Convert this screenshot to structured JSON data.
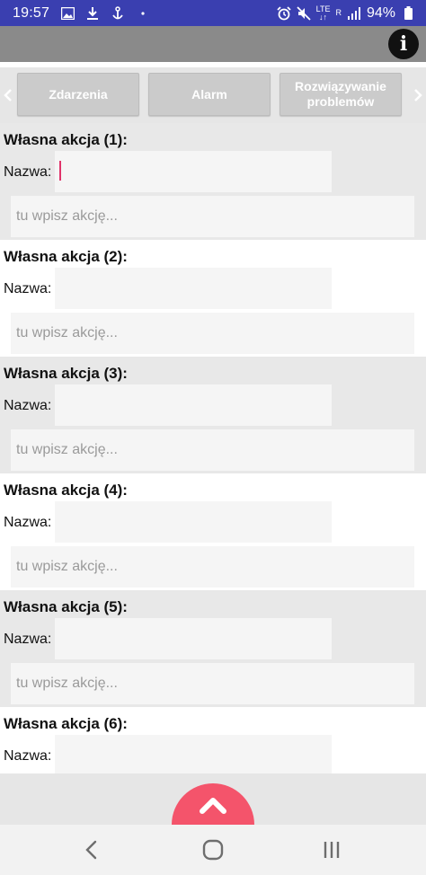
{
  "status_bar": {
    "time": "19:57",
    "network": "LTE",
    "roaming": "R",
    "battery": "94%"
  },
  "tabs": {
    "items": [
      {
        "label": "Zdarzenia"
      },
      {
        "label": "Alarm"
      },
      {
        "label": "Rozwiązywanie problemów"
      }
    ]
  },
  "sections": [
    {
      "title": "Własna akcja (1):",
      "name_label": "Nazwa:",
      "name_value": "",
      "action_placeholder": "tu wpisz akcję..."
    },
    {
      "title": "Własna akcja (2):",
      "name_label": "Nazwa:",
      "name_value": "",
      "action_placeholder": "tu wpisz akcję..."
    },
    {
      "title": "Własna akcja (3):",
      "name_label": "Nazwa:",
      "name_value": "",
      "action_placeholder": "tu wpisz akcję..."
    },
    {
      "title": "Własna akcja (4):",
      "name_label": "Nazwa:",
      "name_value": "",
      "action_placeholder": "tu wpisz akcję..."
    },
    {
      "title": "Własna akcja (5):",
      "name_label": "Nazwa:",
      "name_value": "",
      "action_placeholder": "tu wpisz akcję..."
    },
    {
      "title": "Własna akcja (6):",
      "name_label": "Nazwa:",
      "name_value": ""
    }
  ],
  "colors": {
    "status_bar": "#3a3fb0",
    "fab": "#f4546b",
    "caret": "#e0336a"
  },
  "icons": {
    "info": "info-icon",
    "fab": "chevron-up-icon",
    "nav_back": "back-icon",
    "nav_home": "home-icon",
    "nav_recents": "recents-icon"
  }
}
